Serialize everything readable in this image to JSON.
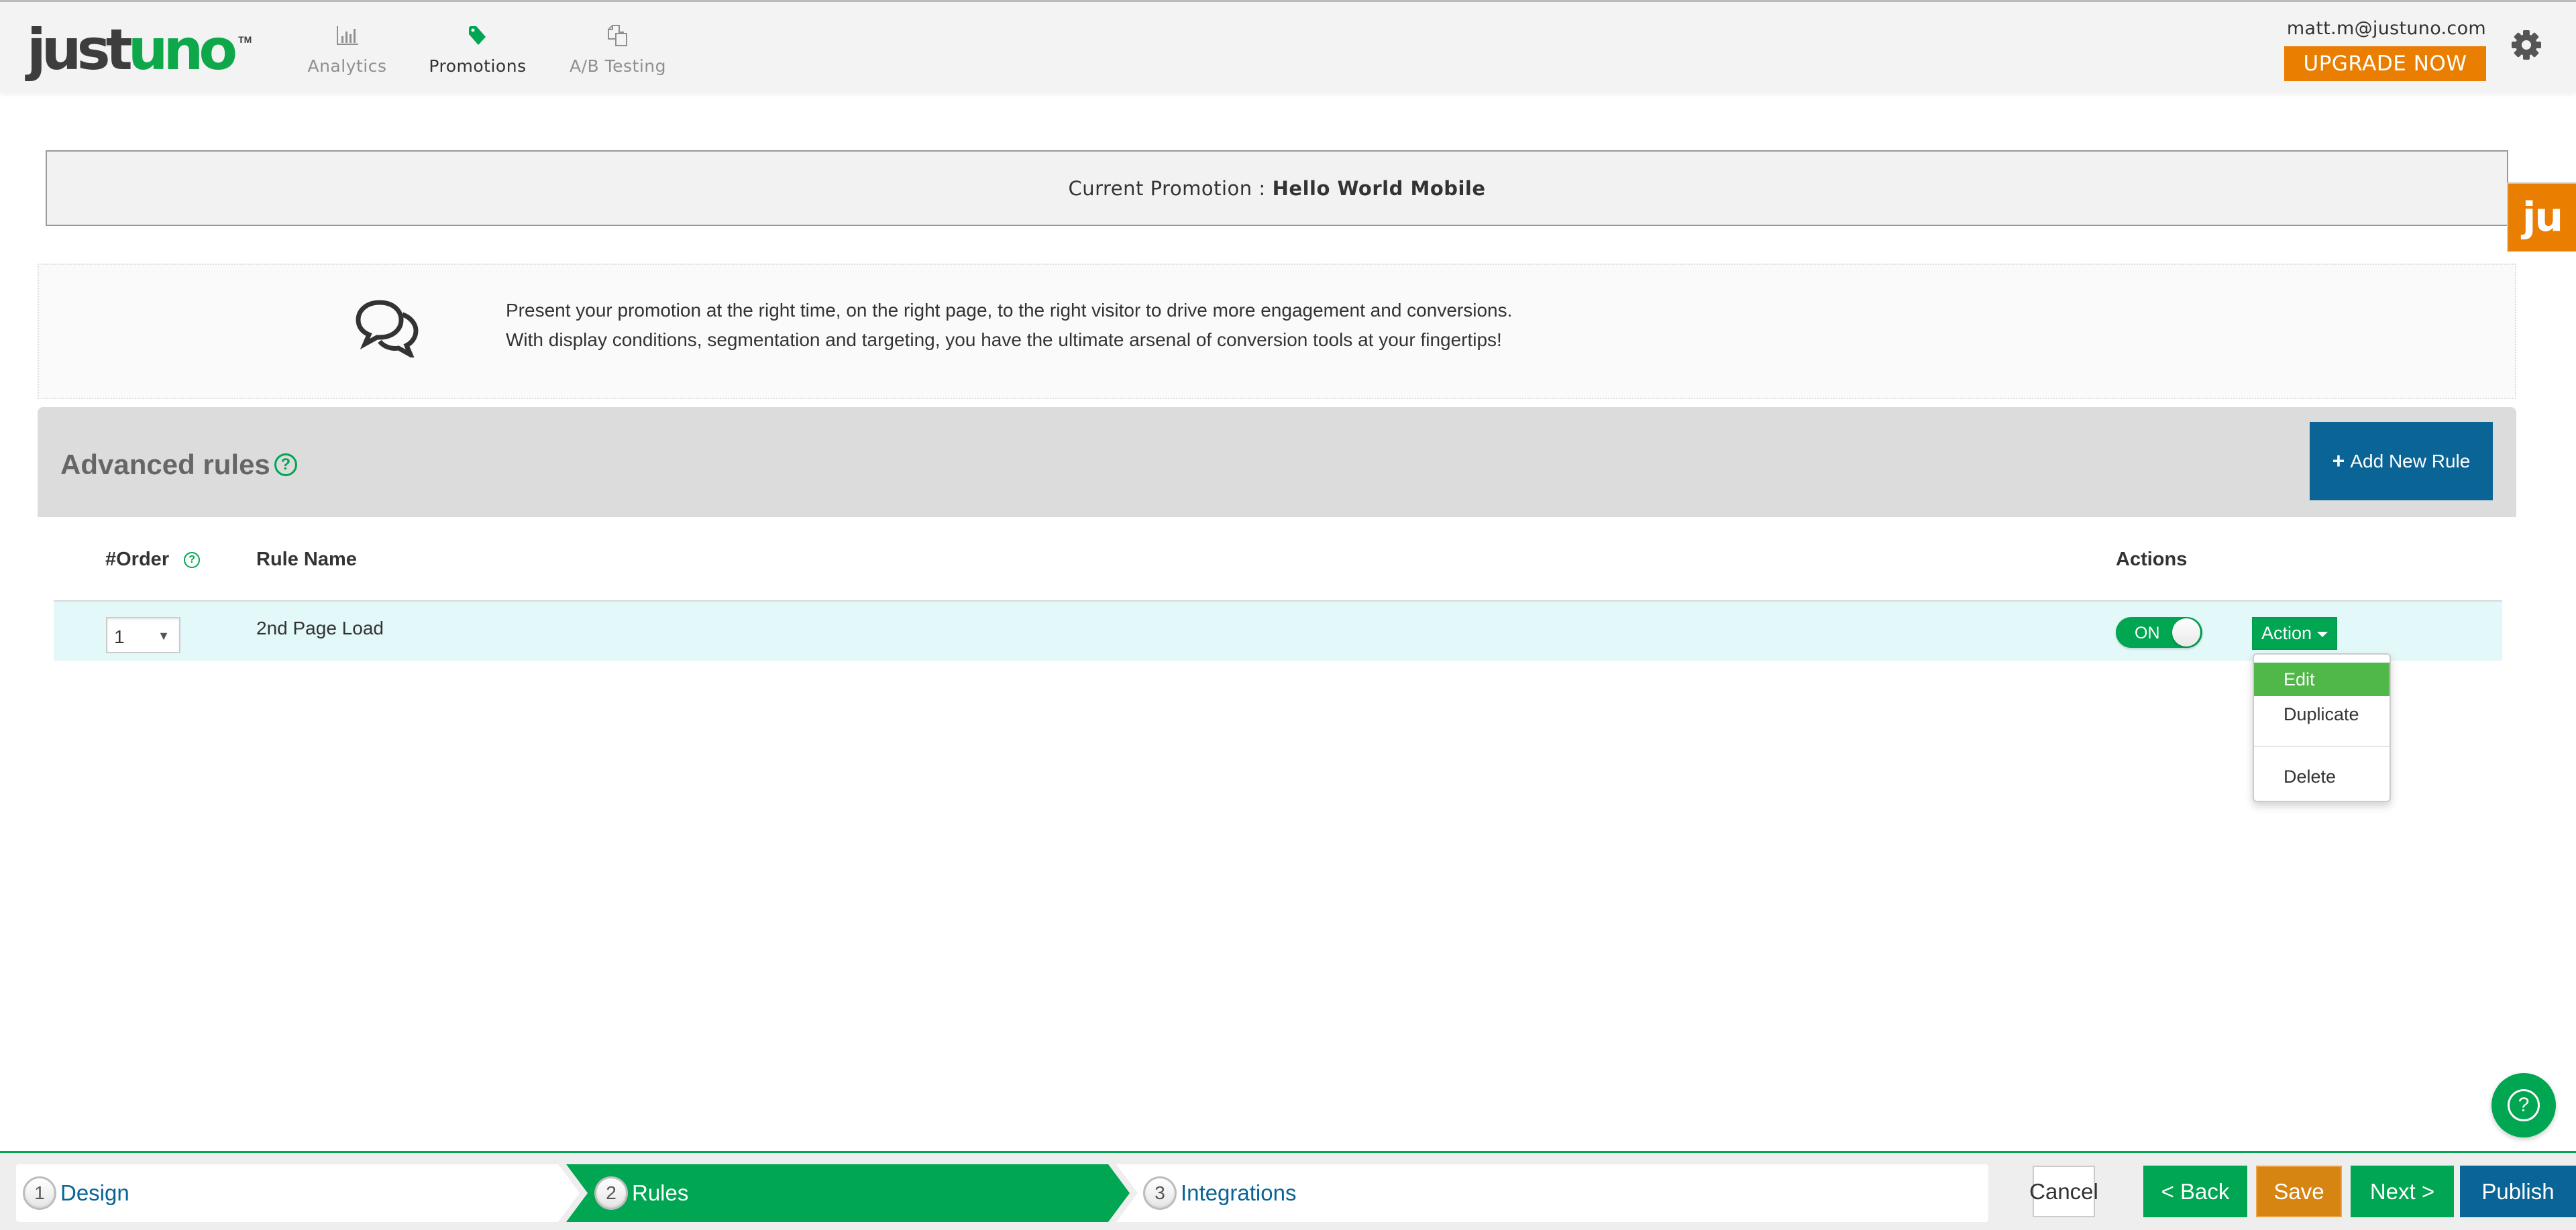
{
  "brand": {
    "logo_part1": "just",
    "logo_part2": "uno",
    "logo_tm": "TM",
    "colors": {
      "green": "#00a651",
      "orange": "#ea7e00",
      "blue": "#0b6496",
      "row_highlight": "#e2f8f9"
    }
  },
  "nav": {
    "items": [
      {
        "label": "Analytics",
        "icon": "bar-chart-icon",
        "active": false
      },
      {
        "label": "Promotions",
        "icon": "tag-icon",
        "active": true
      },
      {
        "label": "A/B Testing",
        "icon": "copy-icon",
        "active": false
      }
    ]
  },
  "account": {
    "email": "matt.m@justuno.com",
    "upgrade_label": "UPGRADE NOW",
    "settings_icon": "gear-icon"
  },
  "current_promotion": {
    "label": "Current Promotion :",
    "name": "Hello World Mobile"
  },
  "side_tab": {
    "label": "ju"
  },
  "info": {
    "icon": "chat-bubbles-icon",
    "line1": "Present your promotion at the right time, on the right page, to the right visitor to drive more engagement and conversions.",
    "line2": "With display conditions, segmentation and targeting, you have the ultimate arsenal of conversion tools at your fingertips!"
  },
  "rules_section": {
    "title": "Advanced rules",
    "help_glyph": "?",
    "add_button": {
      "icon_glyph": "+",
      "label": "Add New Rule"
    }
  },
  "table": {
    "headers": {
      "order": "#Order",
      "rule_name": "Rule Name",
      "actions": "Actions"
    },
    "rows": [
      {
        "order": "1",
        "order_caret": "▼",
        "rule_name": "2nd Page Load",
        "toggle_label": "ON",
        "toggle_on": true,
        "action_label": "Action"
      }
    ]
  },
  "action_menu": {
    "items": [
      {
        "label": "Edit",
        "active": true
      },
      {
        "label": "Duplicate",
        "active": false
      },
      {
        "label": "Delete",
        "active": false
      }
    ]
  },
  "help_fab": {
    "glyph": "?"
  },
  "wizard": {
    "steps": [
      {
        "number": "1",
        "label": "Design",
        "active": false
      },
      {
        "number": "2",
        "label": "Rules",
        "active": true
      },
      {
        "number": "3",
        "label": "Integrations",
        "active": false
      }
    ],
    "buttons": {
      "cancel": "Cancel",
      "back": "< Back",
      "save": "Save",
      "next": "Next >",
      "publish": "Publish"
    }
  }
}
